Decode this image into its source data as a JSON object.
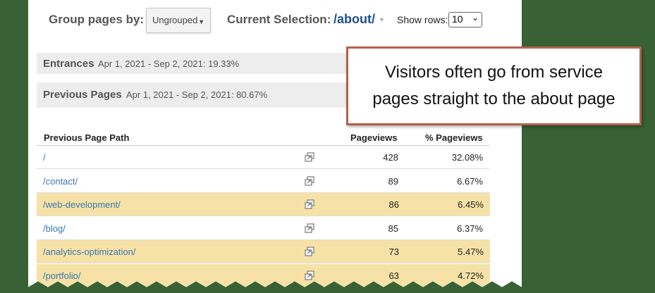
{
  "toolbar": {
    "group_label": "Group pages by:",
    "group_value": "Ungrouped",
    "current_label": "Current Selection:",
    "current_value": "/about/",
    "rows_label": "Show rows:",
    "rows_value": "10"
  },
  "sections": {
    "entrances_title": "Entrances",
    "entrances_sub": "Apr 1, 2021 - Sep 2, 2021: 19.33%",
    "previous_title": "Previous Pages",
    "previous_sub": "Apr 1, 2021 - Sep 2, 2021: 80.67%"
  },
  "table": {
    "headers": [
      "Previous Page Path",
      "Pageviews",
      "% Pageviews"
    ],
    "rows": [
      {
        "path": "/",
        "pageviews": "428",
        "pct": "32.08%",
        "highlight": false
      },
      {
        "path": "/contact/",
        "pageviews": "89",
        "pct": "6.67%",
        "highlight": false
      },
      {
        "path": "/web-development/",
        "pageviews": "86",
        "pct": "6.45%",
        "highlight": true
      },
      {
        "path": "/blog/",
        "pageviews": "85",
        "pct": "6.37%",
        "highlight": false
      },
      {
        "path": "/analytics-optimization/",
        "pageviews": "73",
        "pct": "5.47%",
        "highlight": true
      },
      {
        "path": "/portfolio/",
        "pageviews": "63",
        "pct": "4.72%",
        "highlight": true
      }
    ],
    "row_icon": "open-in-new-window-icon"
  },
  "callout": {
    "line1": "Visitors often go from service",
    "line2": "pages straight to the about page"
  },
  "colors": {
    "background": "#386236",
    "highlight": "#f6e2a6",
    "link": "#3b78b5",
    "callout_border": "#b4614b",
    "current_selection": "#1d4f91"
  }
}
